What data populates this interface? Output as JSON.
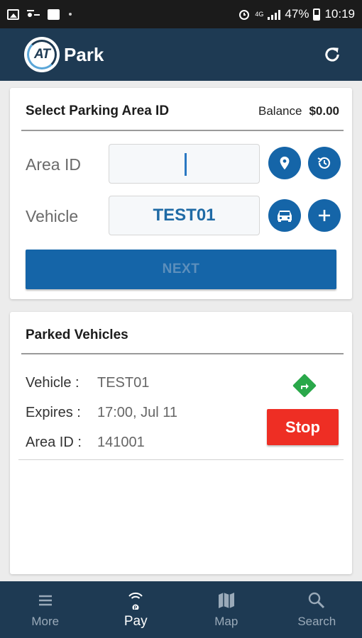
{
  "status_bar": {
    "battery": "47%",
    "time": "10:19",
    "network": "4G"
  },
  "header": {
    "logo_text": "AT",
    "title": "Park"
  },
  "select_card": {
    "title": "Select Parking Area ID",
    "balance_label": "Balance",
    "balance_value": "$0.00",
    "area_id_label": "Area ID",
    "area_id_value": "",
    "vehicle_label": "Vehicle",
    "vehicle_value": "TEST01",
    "next_label": "NEXT"
  },
  "parked_card": {
    "title": "Parked Vehicles",
    "rows": [
      {
        "key": "Vehicle :",
        "value": "TEST01"
      },
      {
        "key": "Expires :",
        "value": "17:00, Jul 11"
      },
      {
        "key": "Area ID :",
        "value": "141001"
      }
    ],
    "stop_label": "Stop"
  },
  "bottom_nav": [
    {
      "label": "More",
      "icon": "menu-icon",
      "active": false
    },
    {
      "label": "Pay",
      "icon": "pay-icon",
      "active": true
    },
    {
      "label": "Map",
      "icon": "map-icon",
      "active": false
    },
    {
      "label": "Search",
      "icon": "search-icon",
      "active": false
    }
  ],
  "colors": {
    "header": "#1e3a53",
    "primary": "#1565a8",
    "stop": "#ee2e24",
    "navigate": "#2aa84a"
  }
}
